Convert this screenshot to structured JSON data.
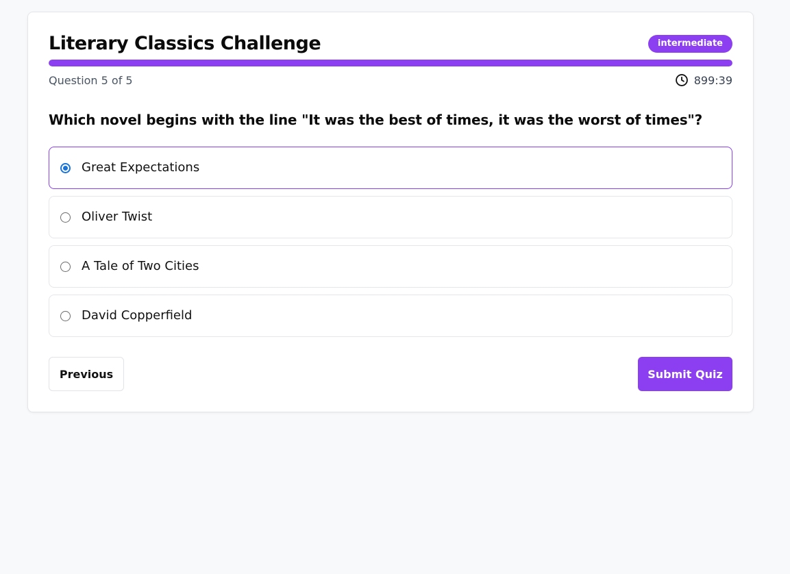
{
  "quiz": {
    "title": "Literary Classics Challenge",
    "difficulty": "intermediate",
    "progress": 1.0,
    "question_counter": "Question 5 of 5",
    "timer": "899:39"
  },
  "question": {
    "text": "Which novel begins with the line \"It was the best of times, it was the worst of times\"?",
    "options": [
      {
        "label": "Great Expectations",
        "selected": true
      },
      {
        "label": "Oliver Twist",
        "selected": false
      },
      {
        "label": "A Tale of Two Cities",
        "selected": false
      },
      {
        "label": "David Copperfield",
        "selected": false
      }
    ]
  },
  "actions": {
    "previous_label": "Previous",
    "submit_label": "Submit Quiz"
  },
  "colors": {
    "accent": "#8b3ff0",
    "radio_selected": "#1a73d9",
    "background": "#f8f9fb"
  },
  "icons": {
    "timer": "clock-icon"
  }
}
